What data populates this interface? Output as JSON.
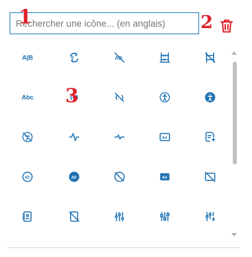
{
  "search": {
    "placeholder": "Rechercher une icône... (en anglais)"
  },
  "actions": {
    "delete_icon": "trash-icon"
  },
  "annotations": [
    "1",
    "2",
    "3"
  ],
  "colors": {
    "icon_blue": "#1f73b4",
    "accent_border": "#1e7fb8",
    "annotation_red": "#e0202a"
  },
  "icons": [
    {
      "name": "a-b-icon",
      "text": "A|B"
    },
    {
      "name": "ab-testing-icon"
    },
    {
      "name": "ab-testing-off-icon"
    },
    {
      "name": "abacus-icon"
    },
    {
      "name": "abacus-off-icon"
    },
    {
      "name": "abc-icon",
      "text": "Abc"
    },
    {
      "name": "access-point-icon"
    },
    {
      "name": "access-point-off-icon"
    },
    {
      "name": "accessible-icon"
    },
    {
      "name": "accessible-filled-icon"
    },
    {
      "name": "accessible-off-icon"
    },
    {
      "name": "activity-icon"
    },
    {
      "name": "activity-heartbeat-icon"
    },
    {
      "name": "ad-icon",
      "text": "Ad"
    },
    {
      "name": "ad-2-icon"
    },
    {
      "name": "ad-circle-icon",
      "text": "AD"
    },
    {
      "name": "ad-circle-filled-icon",
      "text": "AD"
    },
    {
      "name": "ad-circle-off-icon"
    },
    {
      "name": "ad-filled-icon",
      "text": "Ad"
    },
    {
      "name": "ad-off-icon"
    },
    {
      "name": "address-book-icon"
    },
    {
      "name": "address-book-off-icon"
    },
    {
      "name": "adjustments-icon"
    },
    {
      "name": "adjustments-alt-icon"
    },
    {
      "name": "adjustments-bolt-icon"
    }
  ]
}
